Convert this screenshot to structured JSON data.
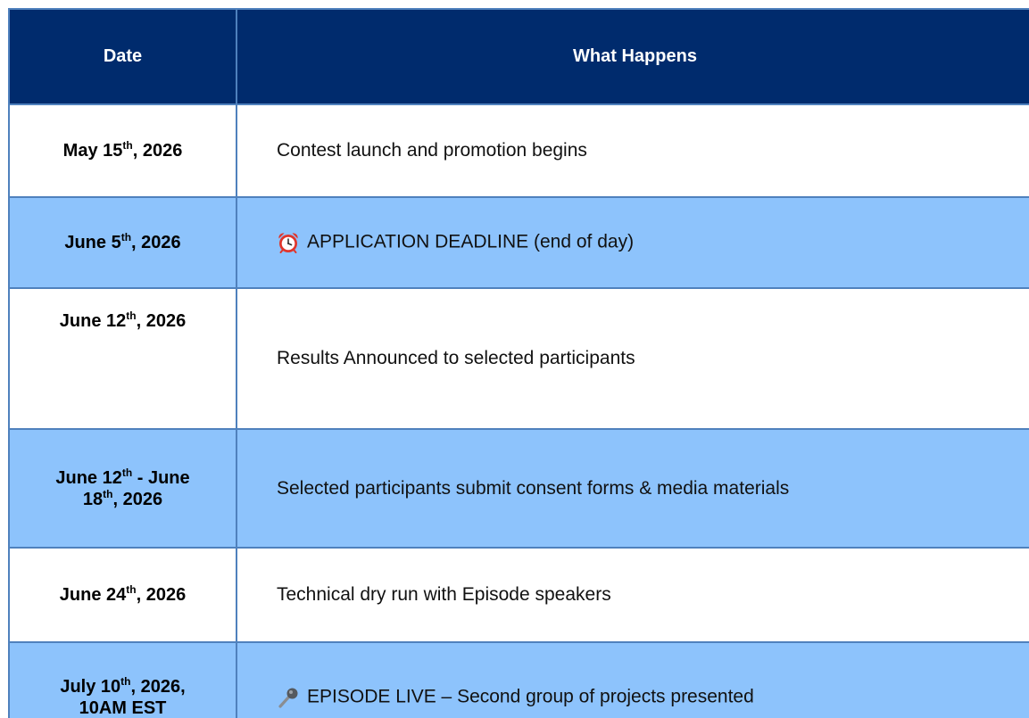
{
  "table": {
    "headers": {
      "date": "Date",
      "what": "What Happens"
    },
    "rows": [
      {
        "date": {
          "p1": "May 15",
          "s1": "th",
          "p2": ", 2026"
        },
        "what": "Contest launch and promotion begins"
      },
      {
        "date": {
          "p1": "June 5",
          "s1": "th",
          "p2": ", 2026"
        },
        "icon": "alarm-clock-icon",
        "what": "APPLICATION DEADLINE (end of day)"
      },
      {
        "date": {
          "p1": "June 12",
          "s1": "th",
          "p2": ", 2026"
        },
        "what": "Results Announced to selected participants"
      },
      {
        "date": {
          "p1": "June 12",
          "s1": "th",
          "p2": " - June",
          "p3": "18",
          "s2": "th",
          "p4": ", 2026"
        },
        "what": "Selected participants submit consent forms & media materials"
      },
      {
        "date": {
          "p1": "June 24",
          "s1": "th",
          "p2": ", 2026"
        },
        "what": "Technical dry run with Episode speakers"
      },
      {
        "date": {
          "p1": "July 10",
          "s1": "th",
          "p2": ", 2026,",
          "p3": "10AM EST"
        },
        "icon": "microphone-icon",
        "what": "EPISODE LIVE – Second group of projects presented"
      }
    ]
  },
  "colors": {
    "header_bg": "#002b6d",
    "header_text": "#ffffff",
    "row_highlight": "#8dc3fc",
    "border": "#4f81bd"
  }
}
